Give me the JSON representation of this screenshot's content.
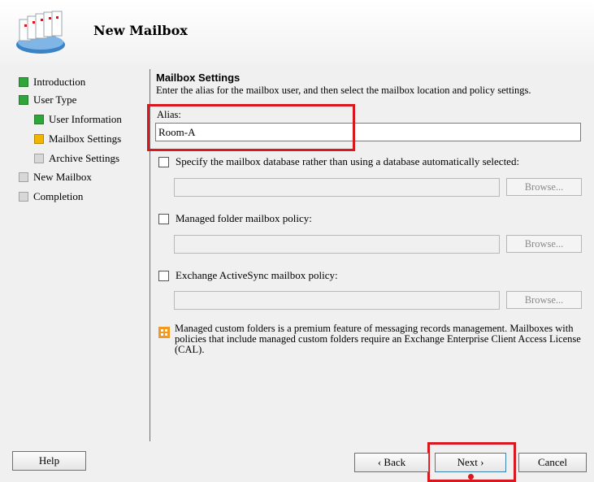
{
  "wizard": {
    "title": "New Mailbox",
    "icon": "mailbox-stack-icon"
  },
  "nav": {
    "items": [
      {
        "label": "Introduction",
        "state": "done",
        "color": "#2fa53a"
      },
      {
        "label": "User Type",
        "state": "done",
        "color": "#2fa53a"
      },
      {
        "label": "User Information",
        "state": "done",
        "color": "#2fa53a"
      },
      {
        "label": "Mailbox Settings",
        "state": "current",
        "color": "#f1b400"
      },
      {
        "label": "Archive Settings",
        "state": "pending",
        "color": "#d8d8d8"
      },
      {
        "label": "New Mailbox",
        "state": "pending",
        "color": "#d8d8d8"
      },
      {
        "label": "Completion",
        "state": "pending",
        "color": "#d8d8d8"
      }
    ]
  },
  "main": {
    "title": "Mailbox Settings",
    "description": "Enter the alias for the mailbox user, and then select the mailbox location and policy settings.",
    "alias": {
      "label": "Alias:",
      "value": "Room-A"
    },
    "options": [
      {
        "label": "Specify the mailbox database rather than using a database automatically selected:",
        "checked": false,
        "field_value": "",
        "browse_label": "Browse..."
      },
      {
        "label": "Managed folder mailbox policy:",
        "checked": false,
        "field_value": "",
        "browse_label": "Browse..."
      },
      {
        "label": "Exchange ActiveSync mailbox policy:",
        "checked": false,
        "field_value": "",
        "browse_label": "Browse..."
      }
    ],
    "info": {
      "icon": "info-warning-icon",
      "text": "Managed custom folders is a premium feature of messaging records management. Mailboxes with policies that include managed custom folders require an Exchange Enterprise Client Access License (CAL)."
    }
  },
  "footer": {
    "help": "Help",
    "back": "‹ Back",
    "next": "Next ›",
    "cancel": "Cancel"
  },
  "colors": {
    "highlight": "#d7181e",
    "accent_done": "#2fa53a",
    "accent_current": "#f1b400"
  }
}
